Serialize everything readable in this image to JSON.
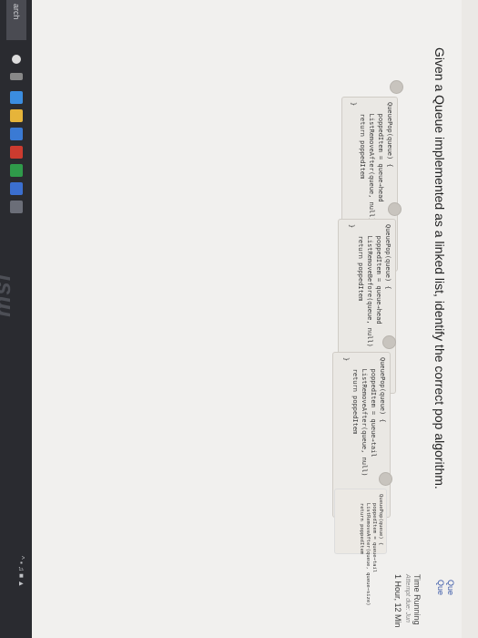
{
  "question": "Given a Queue implemented as a linked list, identify the correct pop algorithm.",
  "sidebar": {
    "links": [
      "Que",
      "Que"
    ],
    "timer_title": "Time Running",
    "attempt_due": "Attempt due: Jun",
    "timer": "1 Hour, 12 Min"
  },
  "options": [
    {
      "code": "QueuePop(queue) {\n   poppedItem = queue→head\n   ListRemoveAfter(queue, null)\n   return poppedItem\n}"
    },
    {
      "code": "QueuePop(queue) {\n   poppedItem = queue→head\n   ListRemoveBefore(queue, null)\n   return poppedItem\n}"
    },
    {
      "code": "QueuePop(queue) {\n   poppedItem = queue→tail\n   ListRemoveAfter(queue, null)\n   return poppedItem\n}"
    },
    {
      "code": "QueuePop(queue) {\n   poppedItem = queue→tail\n   ListRemoveAfter(queue, queue→size)\n   return poppedItem"
    }
  ],
  "taskbar": {
    "search": "arch",
    "brand": "msi"
  },
  "colors": {
    "taskbar": "#2a2b30",
    "link": "#3a58a8"
  }
}
